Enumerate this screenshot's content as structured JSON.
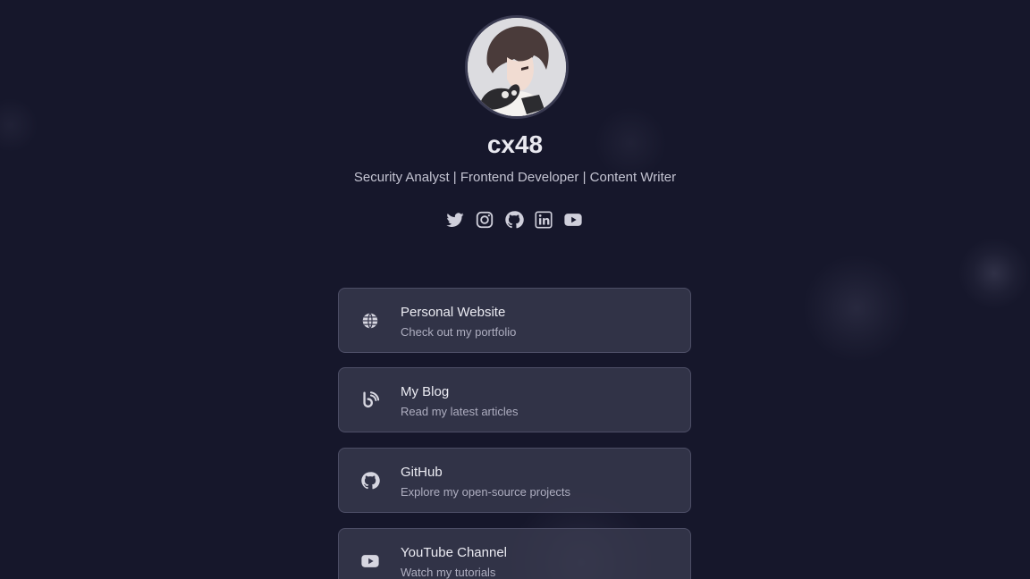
{
  "profile": {
    "name": "cx48",
    "tagline": "Security Analyst | Frontend Developer | Content Writer",
    "avatar_icon": "anime-avatar-portrait"
  },
  "socials": [
    {
      "icon": "twitter-icon"
    },
    {
      "icon": "instagram-icon"
    },
    {
      "icon": "github-icon"
    },
    {
      "icon": "linkedin-icon"
    },
    {
      "icon": "youtube-icon"
    }
  ],
  "links": [
    {
      "icon": "globe-icon",
      "title": "Personal Website",
      "subtitle": "Check out my portfolio"
    },
    {
      "icon": "blog-icon",
      "title": "My Blog",
      "subtitle": "Read my latest articles"
    },
    {
      "icon": "github-icon",
      "title": "GitHub",
      "subtitle": "Explore my open-source projects"
    },
    {
      "icon": "youtube-icon",
      "title": "YouTube Channel",
      "subtitle": "Watch my tutorials"
    }
  ],
  "colors": {
    "background": "#16172b",
    "card": "#3a3b50",
    "text": "#e7e7ef",
    "muted": "#aeaec0"
  }
}
